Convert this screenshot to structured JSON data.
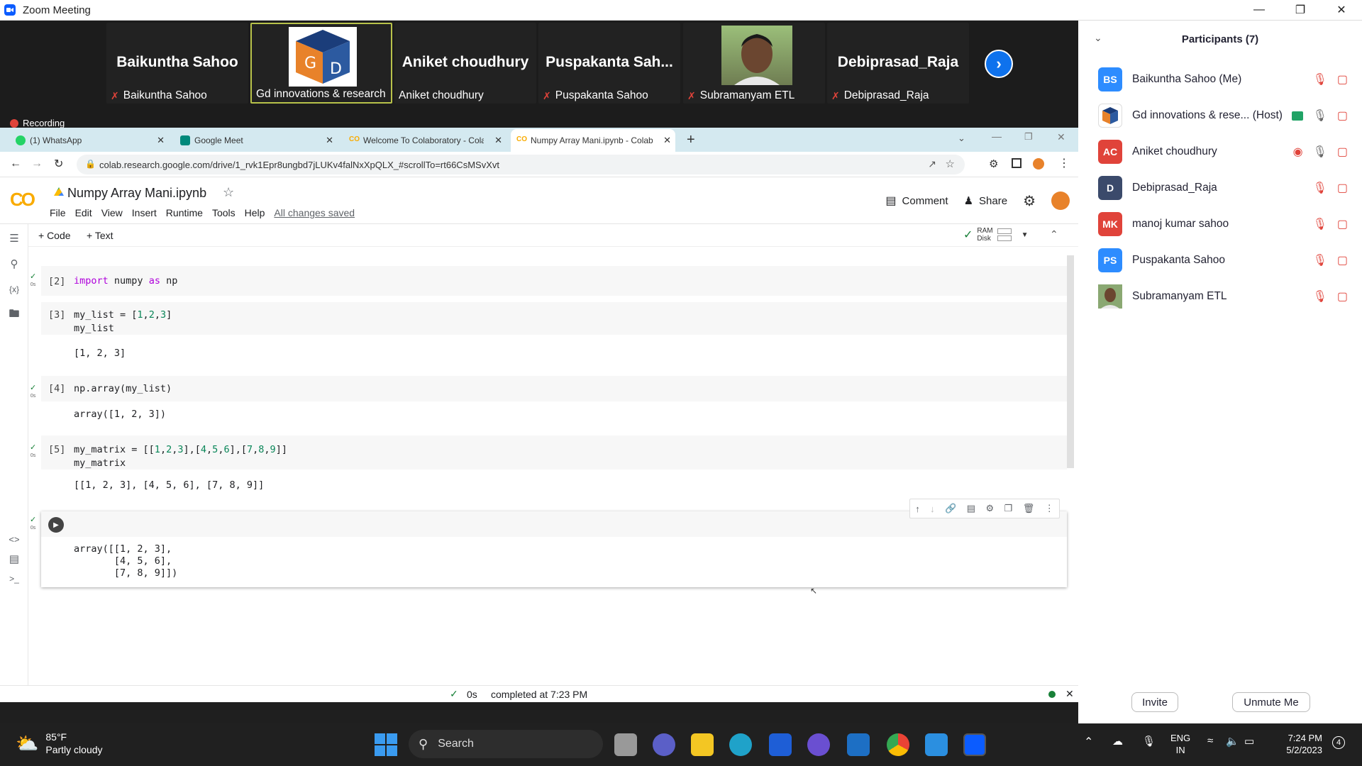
{
  "window": {
    "title": "Zoom Meeting"
  },
  "video_strip": {
    "tiles": [
      {
        "display": "Baikuntha Sahoo",
        "label": "Baikuntha Sahoo",
        "muted": true
      },
      {
        "display": "",
        "label": "Gd innovations & research",
        "muted": false,
        "logo_text": "G D"
      },
      {
        "display": "Aniket choudhury",
        "label": "Aniket choudhury",
        "muted": false
      },
      {
        "display": "Puspakanta  Sah...",
        "label": "Puspakanta Sahoo",
        "muted": true
      },
      {
        "display": "",
        "label": "Subramanyam ETL",
        "muted": true
      },
      {
        "display": "Debiprasad_Raja",
        "label": "Debiprasad_Raja",
        "muted": true
      }
    ],
    "recording": "Recording"
  },
  "browser": {
    "tabs": [
      {
        "label": "(1) WhatsApp",
        "color": "#25d366"
      },
      {
        "label": "Google Meet",
        "color": "#00897b"
      },
      {
        "label": "Welcome To Colaboratory - Cola",
        "color": "#f9ab00"
      },
      {
        "label": "Numpy Array Mani.ipynb - Colab",
        "color": "#f9ab00"
      }
    ],
    "url": "colab.research.google.com/drive/1_rvk1Epr8ungbd7jLUKv4falNxXpQLX_#scrollTo=rt66CsMSvXvt"
  },
  "colab": {
    "logo": "CO",
    "notebook_title": "Numpy Array Mani.ipynb",
    "menus": [
      "File",
      "Edit",
      "View",
      "Insert",
      "Runtime",
      "Tools",
      "Help"
    ],
    "saved": "All changes saved",
    "comment": "Comment",
    "share": "Share",
    "add_code": "+ Code",
    "add_text": "+ Text",
    "ram": "RAM",
    "disk": "Disk",
    "cells": [
      {
        "num": "[2]",
        "time": "0s"
      },
      {
        "num": "[3]",
        "time": ""
      },
      {
        "num": "[4]",
        "time": "0s"
      },
      {
        "num": "[5]",
        "time": "0s"
      },
      {
        "num": "",
        "time": "0s"
      }
    ],
    "outputs": {
      "c3": "[1, 2, 3]",
      "c4": "array([1, 2, 3])",
      "c5": "[[1, 2, 3], [4, 5, 6], [7, 8, 9]]",
      "c6": "array([[1, 2, 3],\n       [4, 5, 6],\n       [7, 8, 9]])"
    },
    "status": {
      "time": "0s",
      "text": "completed at 7:23 PM"
    }
  },
  "participants": {
    "title": "Participants (7)",
    "list": [
      {
        "initials": "BS",
        "name": "Baikuntha Sahoo (Me)",
        "color": "#2d8cff"
      },
      {
        "initials": "",
        "name": "Gd innovations & rese...  (Host)",
        "color": "#ffffff"
      },
      {
        "initials": "AC",
        "name": "Aniket choudhury",
        "color": "#e0433a"
      },
      {
        "initials": "D",
        "name": "Debiprasad_Raja",
        "color": "#3b4a6b"
      },
      {
        "initials": "MK",
        "name": "manoj kumar sahoo",
        "color": "#e0433a"
      },
      {
        "initials": "PS",
        "name": "Puspakanta Sahoo",
        "color": "#2d8cff"
      },
      {
        "initials": "",
        "name": "Subramanyam ETL",
        "color": "#7a6a55"
      }
    ],
    "invite": "Invite",
    "unmute": "Unmute Me"
  },
  "taskbar": {
    "temp": "85°F",
    "weather": "Partly cloudy",
    "search": "Search",
    "lang1": "ENG",
    "lang2": "IN",
    "time": "7:24 PM",
    "date": "5/2/2023",
    "badge": "4"
  }
}
